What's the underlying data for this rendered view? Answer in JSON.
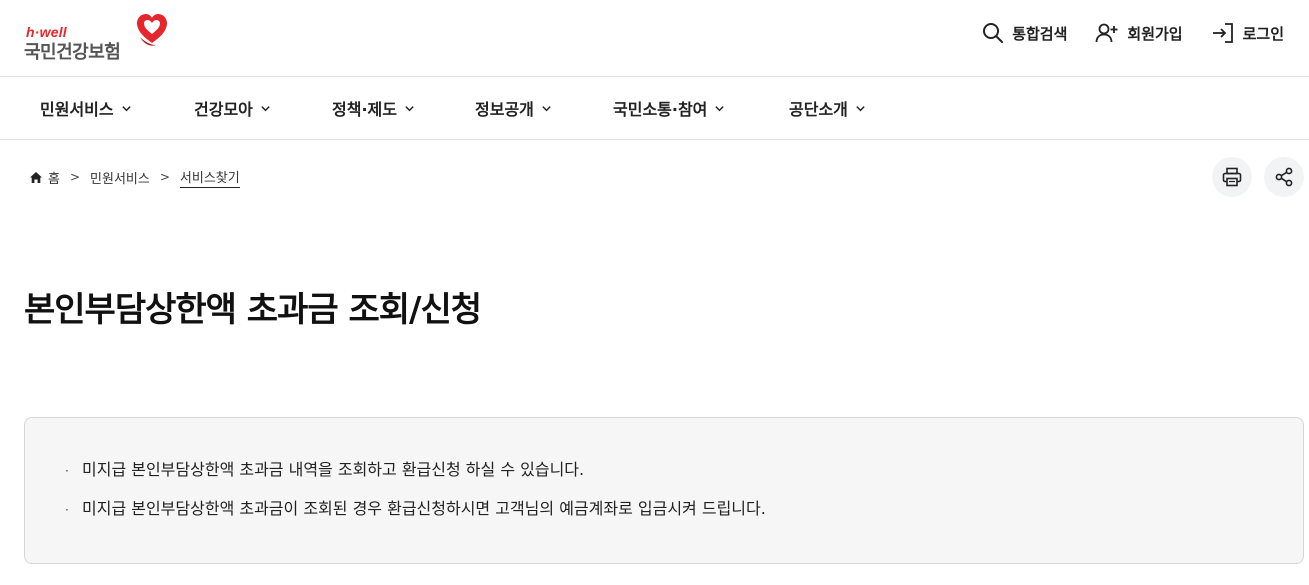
{
  "brand": {
    "tagline": "h·well",
    "name": "국민건강보험",
    "accent_color": "#e6262d"
  },
  "utils": [
    {
      "label": "통합검색",
      "icon": "search-icon"
    },
    {
      "label": "회원가입",
      "icon": "user-add-icon"
    },
    {
      "label": "로그인",
      "icon": "login-icon"
    }
  ],
  "gnb": [
    {
      "label": "민원서비스"
    },
    {
      "label": "건강모아"
    },
    {
      "label": "정책·제도"
    },
    {
      "label": "정보공개"
    },
    {
      "label": "국민소통·참여"
    },
    {
      "label": "공단소개"
    }
  ],
  "breadcrumb": {
    "home": "홈",
    "level1": "민원서비스",
    "current": "서비스찾기"
  },
  "actions": {
    "print_icon": "print-icon",
    "share_icon": "share-icon"
  },
  "page": {
    "title": "본인부담상한액 초과금 조회/신청"
  },
  "info": {
    "items": [
      "미지급 본인부담상한액 초과금 내역을 조회하고 환급신청 하실 수 있습니다.",
      "미지급 본인부담상한액 초과금이 조회된 경우 환급신청하시면 고객님의 예금계좌로 입금시켜 드립니다."
    ]
  }
}
